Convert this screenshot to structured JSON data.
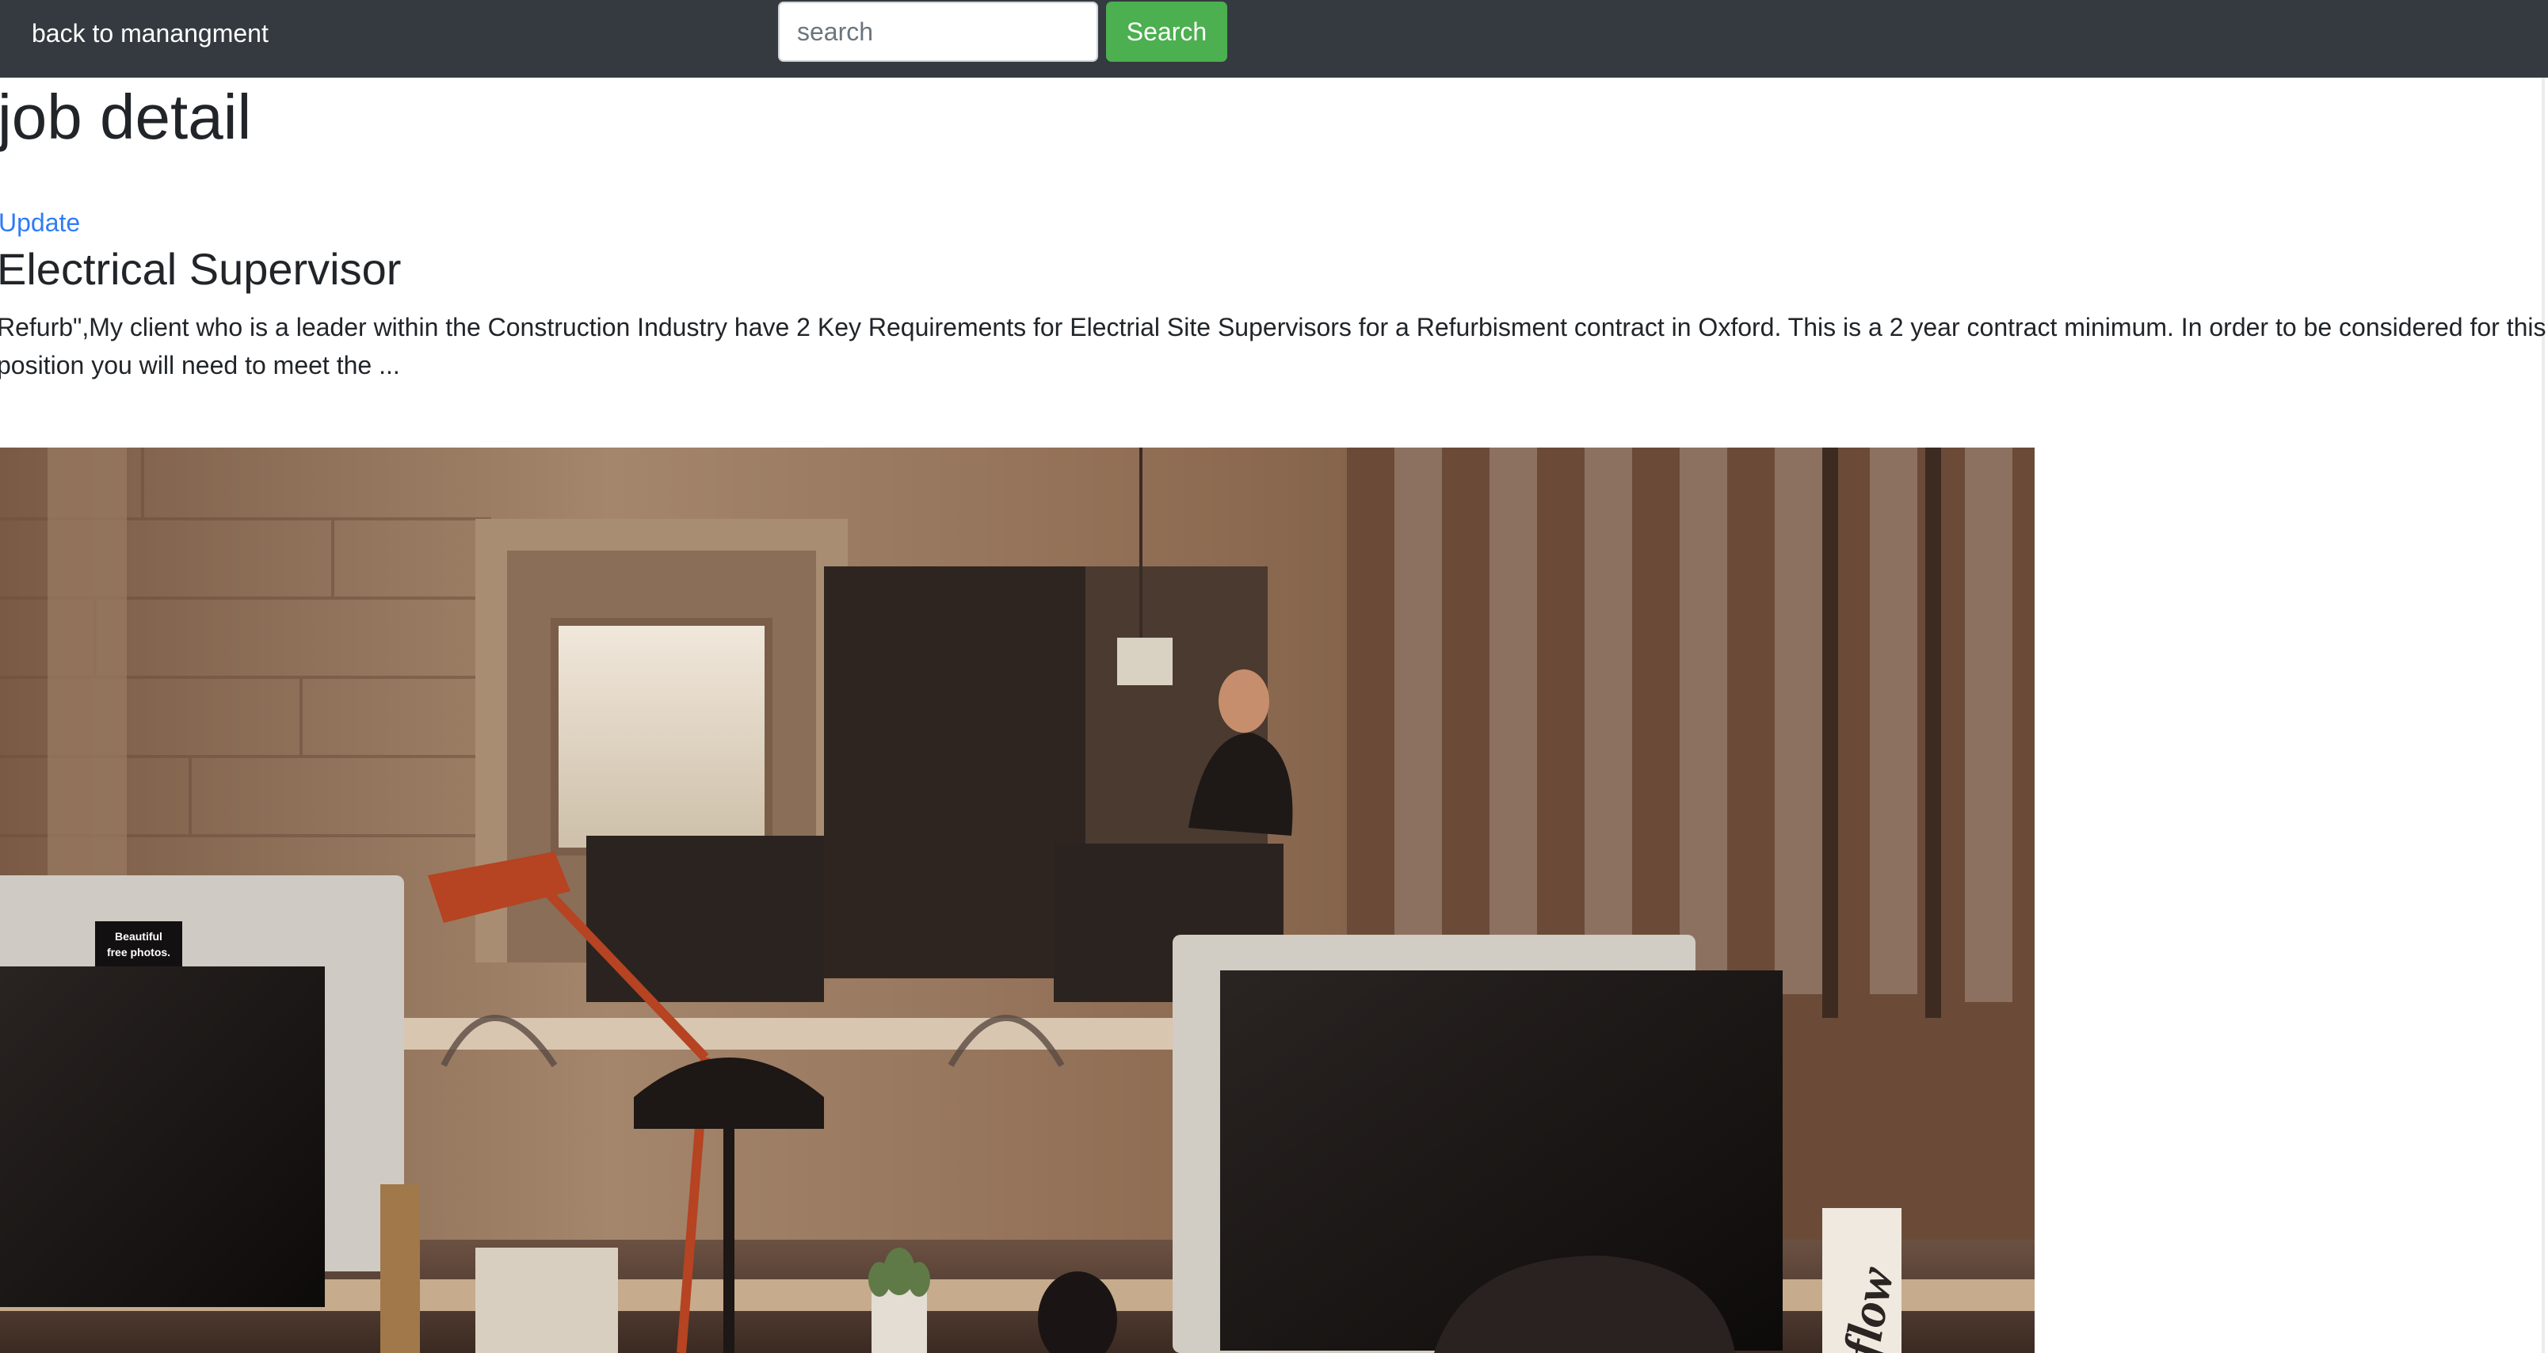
{
  "nav": {
    "back_link": "back to manangment",
    "search_placeholder": "search",
    "search_button": "Search"
  },
  "page": {
    "heading": "job detail",
    "update_link": "Update"
  },
  "job": {
    "title": "Electrical Supervisor",
    "description": "Refurb\",My client who is a leader within the Construction Industry have 2 Key Requirements for Electrial Site Supervisors for a Refurbisment contract in Oxford. This is a 2 year contract minimum. In order to be considered for this position you will need to meet the ...",
    "image_sticker_line1": "Beautiful",
    "image_sticker_line2": "free photos.",
    "image_bottle_text": "flow"
  },
  "colors": {
    "navbar": "#343a40",
    "search_button": "#4caf50",
    "link": "#2f7cf6",
    "text": "#212529"
  }
}
